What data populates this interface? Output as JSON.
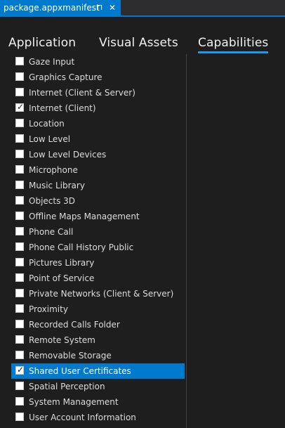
{
  "document_tab": {
    "title": "package.appxmanifest",
    "pin_glyph": "⊓",
    "close_glyph": "✕"
  },
  "section_tabs": [
    {
      "label": "Application",
      "active": false
    },
    {
      "label": "Visual Assets",
      "active": false
    },
    {
      "label": "Capabilities",
      "active": true
    }
  ],
  "capabilities": [
    {
      "label": "Gaze Input",
      "checked": false
    },
    {
      "label": "Graphics Capture",
      "checked": false
    },
    {
      "label": "Internet (Client & Server)",
      "checked": false
    },
    {
      "label": "Internet (Client)",
      "checked": true
    },
    {
      "label": "Location",
      "checked": false
    },
    {
      "label": "Low Level",
      "checked": false
    },
    {
      "label": "Low Level Devices",
      "checked": false
    },
    {
      "label": "Microphone",
      "checked": false
    },
    {
      "label": "Music Library",
      "checked": false
    },
    {
      "label": "Objects 3D",
      "checked": false
    },
    {
      "label": "Offline Maps Management",
      "checked": false
    },
    {
      "label": "Phone Call",
      "checked": false
    },
    {
      "label": "Phone Call History Public",
      "checked": false
    },
    {
      "label": "Pictures Library",
      "checked": false
    },
    {
      "label": "Point of Service",
      "checked": false
    },
    {
      "label": "Private Networks (Client & Server)",
      "checked": false
    },
    {
      "label": "Proximity",
      "checked": false
    },
    {
      "label": "Recorded Calls Folder",
      "checked": false
    },
    {
      "label": "Remote System",
      "checked": false
    },
    {
      "label": "Removable Storage",
      "checked": false
    },
    {
      "label": "Shared User Certificates",
      "checked": true,
      "selected": true
    },
    {
      "label": "Spatial Perception",
      "checked": false
    },
    {
      "label": "System Management",
      "checked": false
    },
    {
      "label": "User Account Information",
      "checked": false
    }
  ],
  "check_glyph": "✓",
  "colors": {
    "accent": "#007acc",
    "tab_underline": "#1c97ea",
    "background": "#1e1e1e"
  }
}
